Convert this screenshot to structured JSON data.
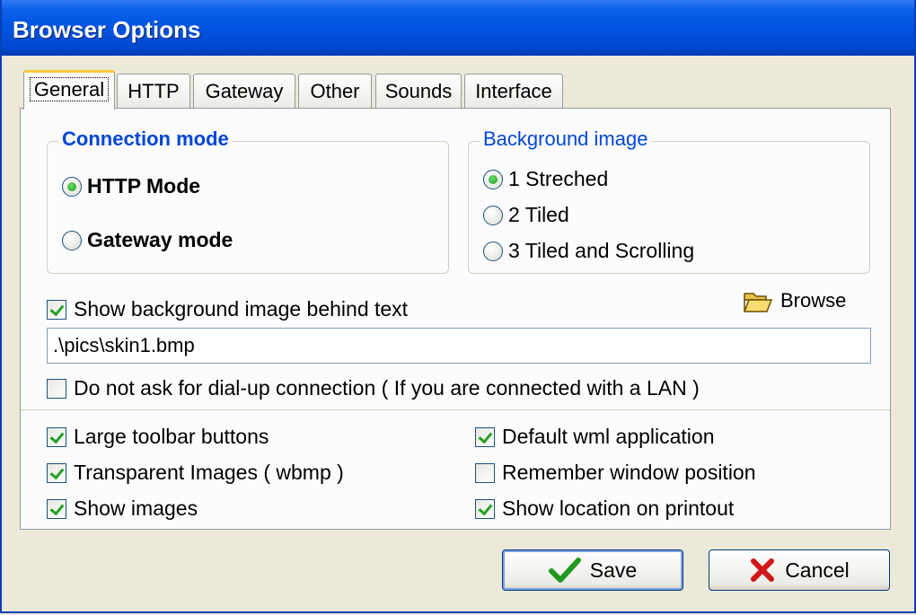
{
  "window": {
    "title": "Browser Options"
  },
  "tabs": [
    "General",
    "HTTP",
    "Gateway",
    "Other",
    "Sounds",
    "Interface"
  ],
  "connection_mode": {
    "legend": "Connection mode",
    "options": [
      {
        "label": "HTTP Mode",
        "selected": true
      },
      {
        "label": "Gateway mode",
        "selected": false
      }
    ]
  },
  "background_image": {
    "legend": "Background image",
    "options": [
      {
        "label": "1 Streched",
        "selected": true
      },
      {
        "label": "2 Tiled",
        "selected": false
      },
      {
        "label": "3 Tiled and Scrolling",
        "selected": false
      }
    ]
  },
  "show_bg": {
    "label": "Show background image behind text",
    "checked": true
  },
  "browse": {
    "label": "Browse",
    "icon": "folder-open-icon"
  },
  "path_field": {
    "value": ".\\pics\\skin1.bmp"
  },
  "dialup": {
    "label": "Do not ask for dial-up connection ( If you are connected with a LAN )",
    "checked": false
  },
  "options_left": [
    {
      "label": "Large toolbar buttons",
      "checked": true
    },
    {
      "label": "Transparent Images ( wbmp )",
      "checked": true
    },
    {
      "label": "Show images",
      "checked": true
    }
  ],
  "options_right": [
    {
      "label": "Default wml application",
      "checked": true
    },
    {
      "label": "Remember window position",
      "checked": false
    },
    {
      "label": "Show location on printout",
      "checked": true
    }
  ],
  "buttons": {
    "save": {
      "label": "Save",
      "icon": "checkmark-icon"
    },
    "cancel": {
      "label": "Cancel",
      "icon": "cross-icon"
    }
  },
  "colors": {
    "title_bar": "#0053e0",
    "accent_green": "#21a121",
    "cancel_red": "#d01818",
    "legend_blue": "#0046d5"
  }
}
